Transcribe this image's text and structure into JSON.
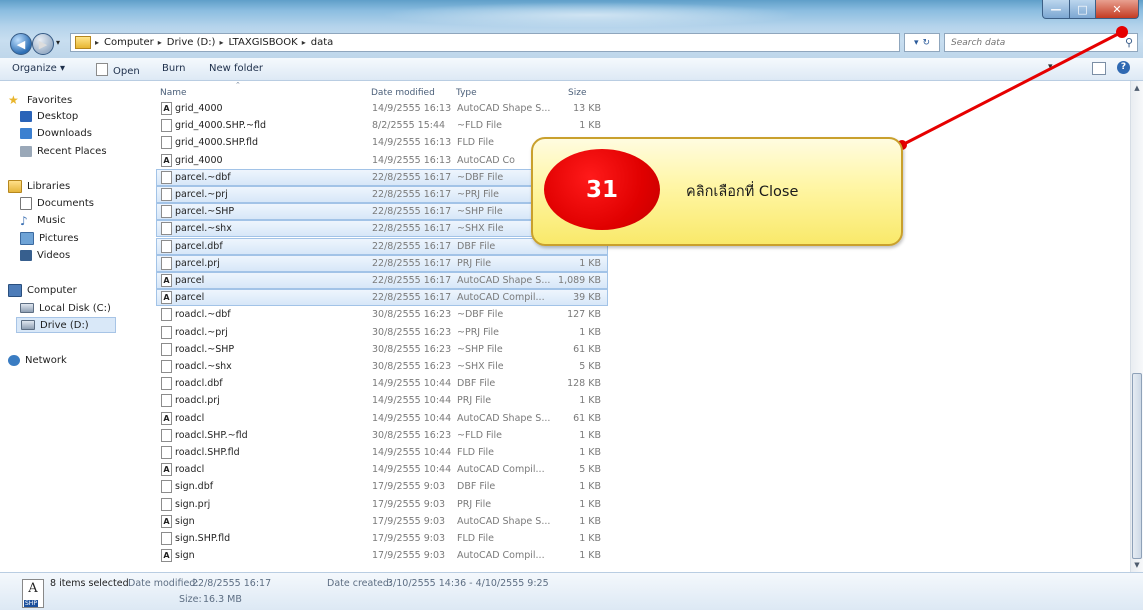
{
  "window": {
    "controls": {
      "minimize": "—",
      "maximize": "□",
      "close": "✕"
    }
  },
  "addressbar": {
    "crumbs": [
      "Computer",
      "Drive (D:)",
      "LTAXGISBOOK",
      "data"
    ],
    "search_placeholder": "Search data"
  },
  "toolbar": {
    "organize": "Organize ▾",
    "open": "Open",
    "burn": "Burn",
    "new_folder": "New folder"
  },
  "navigation": {
    "favorites": "Favorites",
    "desktop": "Desktop",
    "downloads": "Downloads",
    "recent_places": "Recent Places",
    "libraries": "Libraries",
    "documents": "Documents",
    "music": "Music",
    "pictures": "Pictures",
    "videos": "Videos",
    "computer": "Computer",
    "local_disk": "Local Disk (C:)",
    "drive_d": "Drive (D:)",
    "network": "Network"
  },
  "columns": {
    "name": "Name",
    "date": "Date modified",
    "type": "Type",
    "size": "Size"
  },
  "files": [
    {
      "name": "grid_4000",
      "date": "14/9/2555 16:13",
      "type": "AutoCAD Shape S...",
      "size": "13 KB",
      "icon": "shape-file-icon",
      "selected": false
    },
    {
      "name": "grid_4000.SHP.~fld",
      "date": "8/2/2555 15:44",
      "type": "~FLD File",
      "size": "1 KB",
      "icon": "generic-file-icon",
      "selected": false
    },
    {
      "name": "grid_4000.SHP.fld",
      "date": "14/9/2555 16:13",
      "type": "FLD File",
      "size": "",
      "icon": "generic-file-icon",
      "selected": false
    },
    {
      "name": "grid_4000",
      "date": "14/9/2555 16:13",
      "type": "AutoCAD Co",
      "size": "",
      "icon": "shape-file-icon",
      "selected": false
    },
    {
      "name": "parcel.~dbf",
      "date": "22/8/2555 16:17",
      "type": "~DBF File",
      "size": "",
      "icon": "generic-file-icon",
      "selected": true
    },
    {
      "name": "parcel.~prj",
      "date": "22/8/2555 16:17",
      "type": "~PRJ File",
      "size": "",
      "icon": "generic-file-icon",
      "selected": true
    },
    {
      "name": "parcel.~SHP",
      "date": "22/8/2555 16:17",
      "type": "~SHP File",
      "size": "",
      "icon": "generic-file-icon",
      "selected": true
    },
    {
      "name": "parcel.~shx",
      "date": "22/8/2555 16:17",
      "type": "~SHX File",
      "size": "",
      "icon": "generic-file-icon",
      "selected": true
    },
    {
      "name": "parcel.dbf",
      "date": "22/8/2555 16:17",
      "type": "DBF File",
      "size": "",
      "icon": "generic-file-icon",
      "selected": true
    },
    {
      "name": "parcel.prj",
      "date": "22/8/2555 16:17",
      "type": "PRJ File",
      "size": "1 KB",
      "icon": "generic-file-icon",
      "selected": true
    },
    {
      "name": "parcel",
      "date": "22/8/2555 16:17",
      "type": "AutoCAD Shape S...",
      "size": "1,089 KB",
      "icon": "shape-file-icon",
      "selected": true
    },
    {
      "name": "parcel",
      "date": "22/8/2555 16:17",
      "type": "AutoCAD Compil...",
      "size": "39 KB",
      "icon": "shape-file-icon",
      "selected": true
    },
    {
      "name": "roadcl.~dbf",
      "date": "30/8/2555 16:23",
      "type": "~DBF File",
      "size": "127 KB",
      "icon": "generic-file-icon",
      "selected": false
    },
    {
      "name": "roadcl.~prj",
      "date": "30/8/2555 16:23",
      "type": "~PRJ File",
      "size": "1 KB",
      "icon": "generic-file-icon",
      "selected": false
    },
    {
      "name": "roadcl.~SHP",
      "date": "30/8/2555 16:23",
      "type": "~SHP File",
      "size": "61 KB",
      "icon": "generic-file-icon",
      "selected": false
    },
    {
      "name": "roadcl.~shx",
      "date": "30/8/2555 16:23",
      "type": "~SHX File",
      "size": "5 KB",
      "icon": "generic-file-icon",
      "selected": false
    },
    {
      "name": "roadcl.dbf",
      "date": "14/9/2555 10:44",
      "type": "DBF File",
      "size": "128 KB",
      "icon": "generic-file-icon",
      "selected": false
    },
    {
      "name": "roadcl.prj",
      "date": "14/9/2555 10:44",
      "type": "PRJ File",
      "size": "1 KB",
      "icon": "generic-file-icon",
      "selected": false
    },
    {
      "name": "roadcl",
      "date": "14/9/2555 10:44",
      "type": "AutoCAD Shape S...",
      "size": "61 KB",
      "icon": "shape-file-icon",
      "selected": false
    },
    {
      "name": "roadcl.SHP.~fld",
      "date": "30/8/2555 16:23",
      "type": "~FLD File",
      "size": "1 KB",
      "icon": "generic-file-icon",
      "selected": false
    },
    {
      "name": "roadcl.SHP.fld",
      "date": "14/9/2555 10:44",
      "type": "FLD File",
      "size": "1 KB",
      "icon": "generic-file-icon",
      "selected": false
    },
    {
      "name": "roadcl",
      "date": "14/9/2555 10:44",
      "type": "AutoCAD Compil...",
      "size": "5 KB",
      "icon": "shape-file-icon",
      "selected": false
    },
    {
      "name": "sign.dbf",
      "date": "17/9/2555 9:03",
      "type": "DBF File",
      "size": "1 KB",
      "icon": "generic-file-icon",
      "selected": false
    },
    {
      "name": "sign.prj",
      "date": "17/9/2555 9:03",
      "type": "PRJ File",
      "size": "1 KB",
      "icon": "generic-file-icon",
      "selected": false
    },
    {
      "name": "sign",
      "date": "17/9/2555 9:03",
      "type": "AutoCAD Shape S...",
      "size": "1 KB",
      "icon": "shape-file-icon",
      "selected": false
    },
    {
      "name": "sign.SHP.fld",
      "date": "17/9/2555 9:03",
      "type": "FLD File",
      "size": "1 KB",
      "icon": "generic-file-icon",
      "selected": false
    },
    {
      "name": "sign",
      "date": "17/9/2555 9:03",
      "type": "AutoCAD Compil...",
      "size": "1 KB",
      "icon": "shape-file-icon",
      "selected": false
    }
  ],
  "details": {
    "thumb_glyph": "A",
    "thumb_tag": "SHP",
    "selected_count": "8 items selected",
    "modified_label": "Date modified:",
    "modified": "22/8/2555 16:17",
    "size_label": "Size:",
    "size": "16.3 MB",
    "created_label": "Date created:",
    "created": "3/10/2555 14:36 - 4/10/2555 9:25"
  },
  "annotation": {
    "step_number": "31",
    "instruction": "คลิกเลือกที่  Close",
    "badge_color": "#e60000",
    "box_color": "#fff6a5",
    "pointer_color": "#e60000"
  }
}
